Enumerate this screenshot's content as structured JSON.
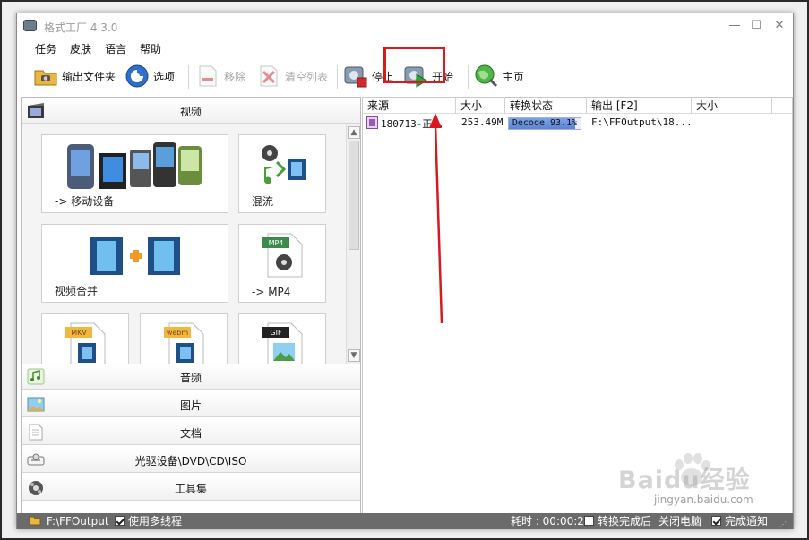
{
  "window": {
    "title": "格式工厂 4.3.0",
    "controls": {
      "minimize": "—",
      "maximize": "☐",
      "close": "✕"
    }
  },
  "menu": [
    "任务",
    "皮肤",
    "语言",
    "帮助"
  ],
  "toolbar": {
    "output_folder": "输出文件夹",
    "options": "选项",
    "remove": "移除",
    "clear_list": "清空列表",
    "stop": "停止",
    "start": "开始",
    "home": "主页"
  },
  "categories": {
    "video": "视频",
    "audio": "音频",
    "image": "图片",
    "document": "文档",
    "rom": "光驱设备\\DVD\\CD\\ISO",
    "tools": "工具集"
  },
  "tiles": {
    "mobile": "-> 移动设备",
    "mux": "混流",
    "join": "视频合并",
    "mp4": "-> MP4",
    "mp4_badge": "MP4",
    "mkv_badge": "MKV",
    "webm_badge": "webm",
    "gif_badge": "GIF"
  },
  "task_list": {
    "columns": [
      "来源",
      "大小",
      "转换状态",
      "输出 [F2]",
      "大小"
    ],
    "rows": [
      {
        "source": "180713-正 .",
        "size": "253.49M",
        "status": "Decode 93.1%",
        "progress": 0.931,
        "output": "F:\\FFOutput\\18...",
        "out_size": ""
      }
    ]
  },
  "statusbar": {
    "folder": "F:\\FFOutput",
    "multithread": "使用多线程",
    "elapsed_label": "耗时 : 00:00:27",
    "after_convert": "转换完成后",
    "shutdown": "关闭电脑",
    "notify": "完成通知"
  },
  "watermark": {
    "text": "Baidu经验",
    "url": "jingyan.baidu.com"
  },
  "colors": {
    "highlight": "#d9191f",
    "progress": "#5a84d8",
    "statusbar": "#6b6b6b"
  }
}
